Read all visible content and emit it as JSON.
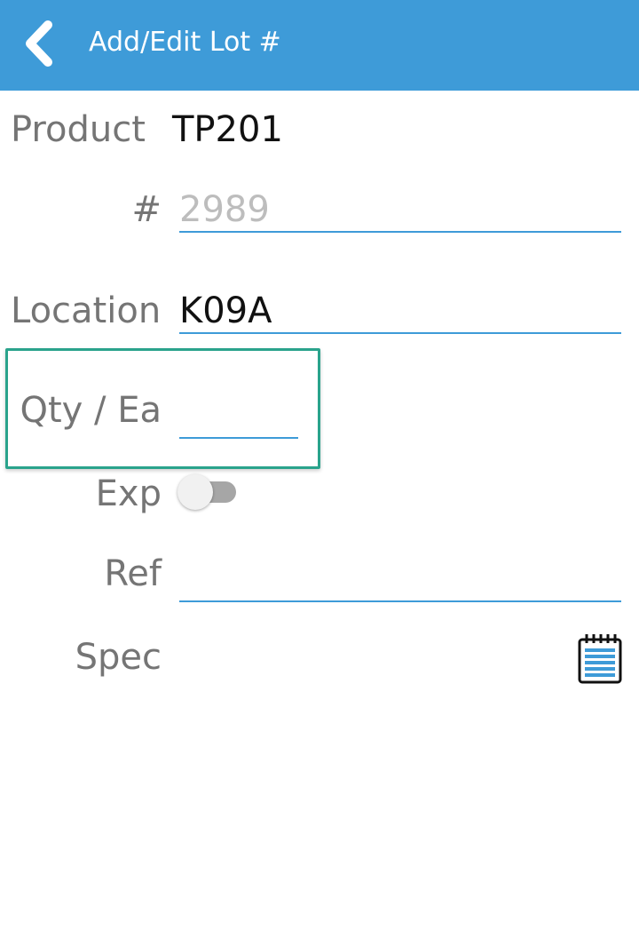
{
  "header": {
    "title": "Add/Edit Lot #",
    "back_icon": "chevron-left-icon",
    "background_color": "#3e9bd8"
  },
  "form": {
    "product": {
      "label": "Product",
      "value": "TP201"
    },
    "lot_number": {
      "label": "#",
      "value": "",
      "placeholder": "2989"
    },
    "location": {
      "label": "Location",
      "value": "K09A"
    },
    "qty": {
      "label": "Qty / Ea",
      "value": ""
    },
    "exp": {
      "label": "Exp",
      "toggle_on": false
    },
    "ref": {
      "label": "Ref",
      "value": ""
    },
    "spec": {
      "label": "Spec",
      "icon": "notepad-icon"
    }
  },
  "colors": {
    "accent": "#3e9bd8",
    "focus_highlight": "#2aa38c",
    "label_text": "#757575"
  }
}
